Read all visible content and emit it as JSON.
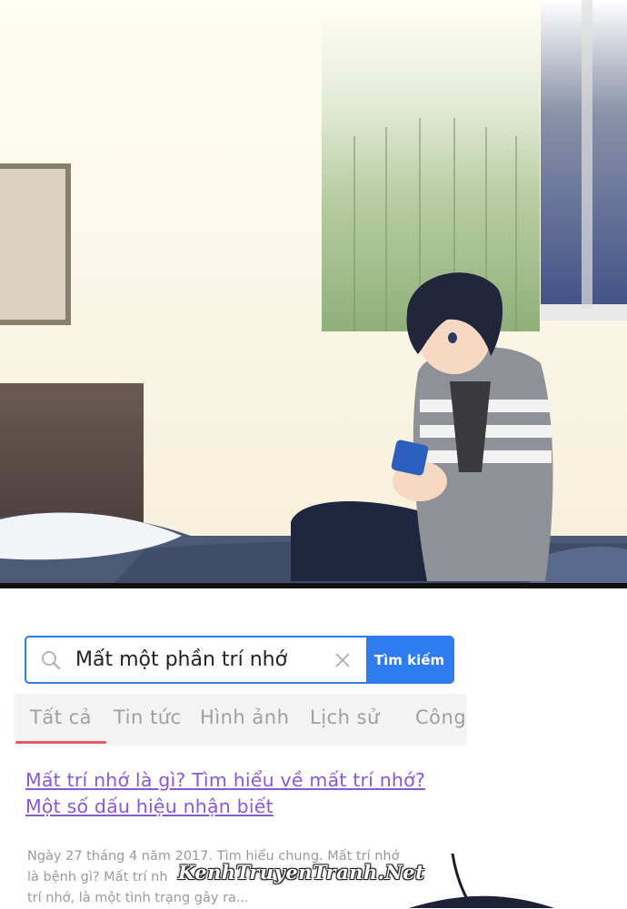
{
  "search": {
    "query": "Mất một phần trí nhớ",
    "button_label": "Tìm kiếm",
    "icon": "search-icon",
    "clear_icon": "close-icon"
  },
  "tabs": [
    {
      "label": "Tất cả",
      "active": true
    },
    {
      "label": "Tin tức",
      "active": false
    },
    {
      "label": "Hình ảnh",
      "active": false
    },
    {
      "label": "Lịch sử",
      "active": false
    },
    {
      "label": "Công",
      "active": false
    }
  ],
  "result": {
    "title_line1": "Mất trí nhớ là gì? Tìm hiểu về mất trí nhớ?",
    "title_line2": "Một số dấu hiệu nhận biết",
    "snippet_line1": "Ngày 27 tháng 4 năm 2017. Tìm hiểu chung. Mất trí nhớ",
    "snippet_line2": "là bệnh gì? Mất trí nh",
    "snippet_line3": "trí nhớ, là một tình trạng gây ra..."
  },
  "watermark": "KenhTruyenTranh.Net",
  "colors": {
    "accent": "#2f7bf0",
    "tab_underline": "#e85a66",
    "link_visited": "#8a58d6",
    "snippet": "#9a9a9a"
  }
}
